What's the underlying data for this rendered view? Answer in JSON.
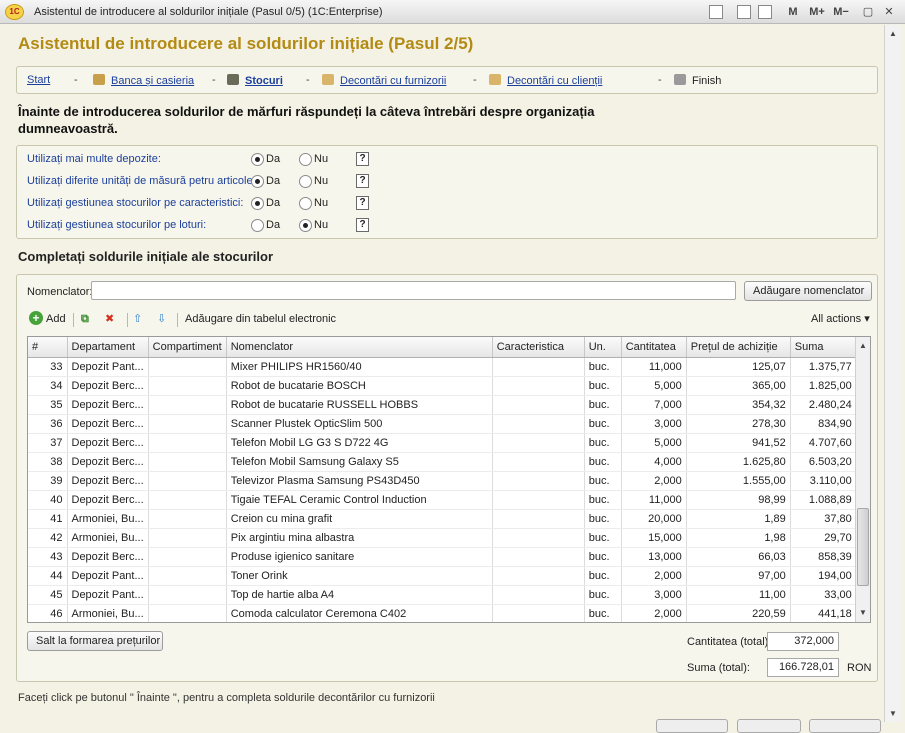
{
  "window": {
    "title": "Asistentul de introducere al soldurilor inițiale (Pasul 0/5)  (1C:Enterprise)",
    "logo": "1C",
    "buttons": {
      "mem": "M",
      "mem_plus": "M+",
      "mem_minus": "M−"
    }
  },
  "page": {
    "title": "Asistentul de introducere al soldurilor inițiale (Pasul 2/5)"
  },
  "steps": [
    {
      "label": "Start",
      "icon": "",
      "active": false,
      "link": true
    },
    {
      "label": "Banca și casieria",
      "icon": "bank-icon",
      "active": false,
      "link": true
    },
    {
      "label": "Stocuri",
      "icon": "warehouse-icon",
      "active": true,
      "link": true
    },
    {
      "label": "Decontări cu furnizorii",
      "icon": "suppliers-icon",
      "active": false,
      "link": true
    },
    {
      "label": "Decontări cu clienții",
      "icon": "clients-icon",
      "active": false,
      "link": true
    },
    {
      "label": "Finish",
      "icon": "finish-icon",
      "active": false,
      "link": false
    }
  ],
  "steps_separator": "-",
  "question": "Înainte de introducerea soldurilor de mărfuri răspundeți la câteva întrebări despre organizația dumneavoastră.",
  "options": {
    "yes_label": "Da",
    "no_label": "Nu",
    "help_label": "?",
    "items": [
      {
        "label": "Utilizați mai multe depozite:",
        "value": "Da"
      },
      {
        "label": "Utilizați diferite unități de măsură petru articole:",
        "value": "Da"
      },
      {
        "label": "Utilizați gestiunea stocurilor pe caracteristici:",
        "value": "Da"
      },
      {
        "label": "Utilizați gestiunea stocurilor pe loturi:",
        "value": "Nu"
      }
    ]
  },
  "stocks": {
    "section_title": "Completați soldurile inițiale ale stocurilor",
    "nomenclator_label": "Nomenclator:",
    "nomenclator_value": "",
    "add_nomenclator_button": "Adăugare nomenclator",
    "toolbar": {
      "add": "Add",
      "add_from_spreadsheet": "Adăugare din tabelul electronic",
      "all_actions": "All actions ▾"
    },
    "columns": [
      "#",
      "Departament",
      "Compartiment",
      "Nomenclator",
      "Caracteristica",
      "Un.",
      "Cantitatea",
      "Prețul de achiziție",
      "Suma"
    ],
    "rows": [
      [
        "33",
        "Depozit Pant...",
        "",
        "Mixer PHILIPS HR1560/40",
        "",
        "buc.",
        "11,000",
        "125,07",
        "1.375,77"
      ],
      [
        "34",
        "Depozit Berc...",
        "",
        "Robot de bucatarie BOSCH",
        "",
        "buc.",
        "5,000",
        "365,00",
        "1.825,00"
      ],
      [
        "35",
        "Depozit Berc...",
        "",
        "Robot de bucatarie RUSSELL HOBBS",
        "",
        "buc.",
        "7,000",
        "354,32",
        "2.480,24"
      ],
      [
        "36",
        "Depozit Berc...",
        "",
        "Scanner Plustek OpticSlim 500",
        "",
        "buc.",
        "3,000",
        "278,30",
        "834,90"
      ],
      [
        "37",
        "Depozit Berc...",
        "",
        "Telefon Mobil LG G3 S D722 4G",
        "",
        "buc.",
        "5,000",
        "941,52",
        "4.707,60"
      ],
      [
        "38",
        "Depozit Berc...",
        "",
        "Telefon Mobil Samsung Galaxy S5",
        "",
        "buc.",
        "4,000",
        "1.625,80",
        "6.503,20"
      ],
      [
        "39",
        "Depozit Berc...",
        "",
        "Televizor Plasma Samsung PS43D450",
        "",
        "buc.",
        "2,000",
        "1.555,00",
        "3.110,00"
      ],
      [
        "40",
        "Depozit Berc...",
        "",
        "Tigaie TEFAL Ceramic Control Induction",
        "",
        "buc.",
        "11,000",
        "98,99",
        "1.088,89"
      ],
      [
        "41",
        "Armoniei, Bu...",
        "",
        "Creion cu mina grafit",
        "",
        "buc.",
        "20,000",
        "1,89",
        "37,80"
      ],
      [
        "42",
        "Armoniei, Bu...",
        "",
        "Pix argintiu mina albastra",
        "",
        "buc.",
        "15,000",
        "1,98",
        "29,70"
      ],
      [
        "43",
        "Depozit Berc...",
        "",
        "Produse igienico sanitare",
        "",
        "buc.",
        "13,000",
        "66,03",
        "858,39"
      ],
      [
        "44",
        "Depozit Pant...",
        "",
        "Toner Orink",
        "",
        "buc.",
        "2,000",
        "97,00",
        "194,00"
      ],
      [
        "45",
        "Depozit Pant...",
        "",
        "Top de hartie alba A4",
        "",
        "buc.",
        "3,000",
        "11,00",
        "33,00"
      ],
      [
        "46",
        "Armoniei, Bu...",
        "",
        "Comoda calculator Ceremona C402",
        "",
        "buc.",
        "2,000",
        "220,59",
        "441,18"
      ]
    ],
    "price_jump_button": "Salt la formarea prețurilor",
    "total_quantity_label": "Cantitatea (total):",
    "total_quantity": "372,000",
    "total_sum_label": "Suma (total):",
    "total_sum": "166.728,01",
    "currency": "RON"
  },
  "hint": "Faceți click pe butonul \" Înainte \", pentru a completa soldurile decontărilor cu furnizorii"
}
